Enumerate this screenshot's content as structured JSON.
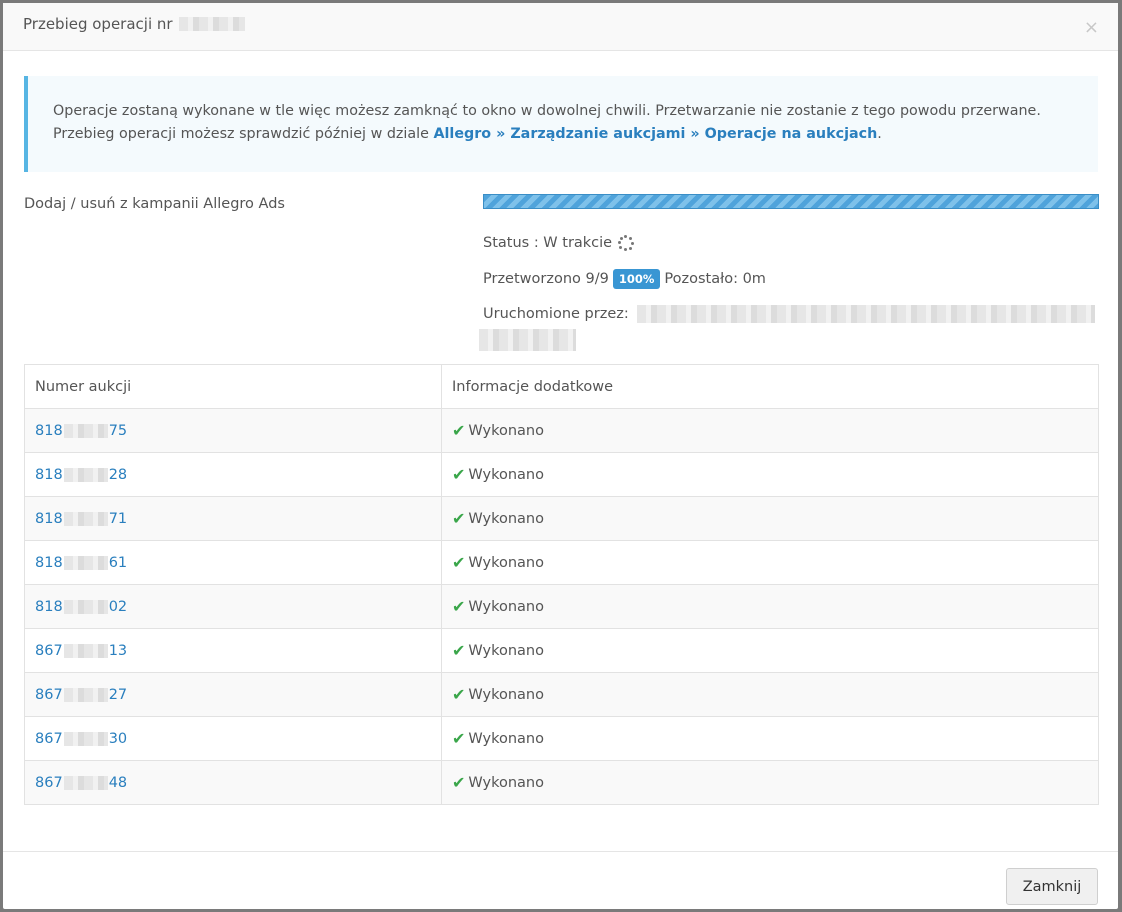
{
  "modal": {
    "title": "Przebieg operacji nr",
    "close_icon": "×"
  },
  "info": {
    "text_before": "Operacje zostaną wykonane w tle więc możesz zamknąć to okno w dowolnej chwili. Przetwarzanie nie zostanie z tego powodu przerwane. Przebieg operacji możesz sprawdzić później w dziale ",
    "link": "Allegro » Zarządzanie aukcjami » Operacje na aukcjach",
    "text_after": "."
  },
  "operation": {
    "label": "Dodaj / usuń z kampanii Allegro Ads",
    "progress_percent": 100,
    "status": "Status : W trakcie",
    "processed": "Przetworzono 9/9",
    "badge": "100%",
    "remaining": "Pozostało: 0m",
    "started_by": "Uruchomione przez:"
  },
  "table": {
    "headers": [
      "Numer aukcji",
      "Informacje dodatkowe"
    ],
    "rows": [
      {
        "prefix": "818",
        "suffix": "75",
        "info": "Wykonano"
      },
      {
        "prefix": "818",
        "suffix": "28",
        "info": "Wykonano"
      },
      {
        "prefix": "818",
        "suffix": "71",
        "info": "Wykonano"
      },
      {
        "prefix": "818",
        "suffix": "61",
        "info": "Wykonano"
      },
      {
        "prefix": "818",
        "suffix": "02",
        "info": "Wykonano"
      },
      {
        "prefix": "867",
        "suffix": "13",
        "info": "Wykonano"
      },
      {
        "prefix": "867",
        "suffix": "27",
        "info": "Wykonano"
      },
      {
        "prefix": "867",
        "suffix": "30",
        "info": "Wykonano"
      },
      {
        "prefix": "867",
        "suffix": "48",
        "info": "Wykonano"
      }
    ]
  },
  "footer": {
    "close_label": "Zamknij"
  },
  "colors": {
    "link": "#2a7fbe",
    "accent": "#57b5e3",
    "badge": "#3996d3",
    "check": "#3aa64a"
  },
  "icons": {
    "close": "close-icon",
    "spinner": "spinner-icon",
    "check": "check-icon"
  }
}
